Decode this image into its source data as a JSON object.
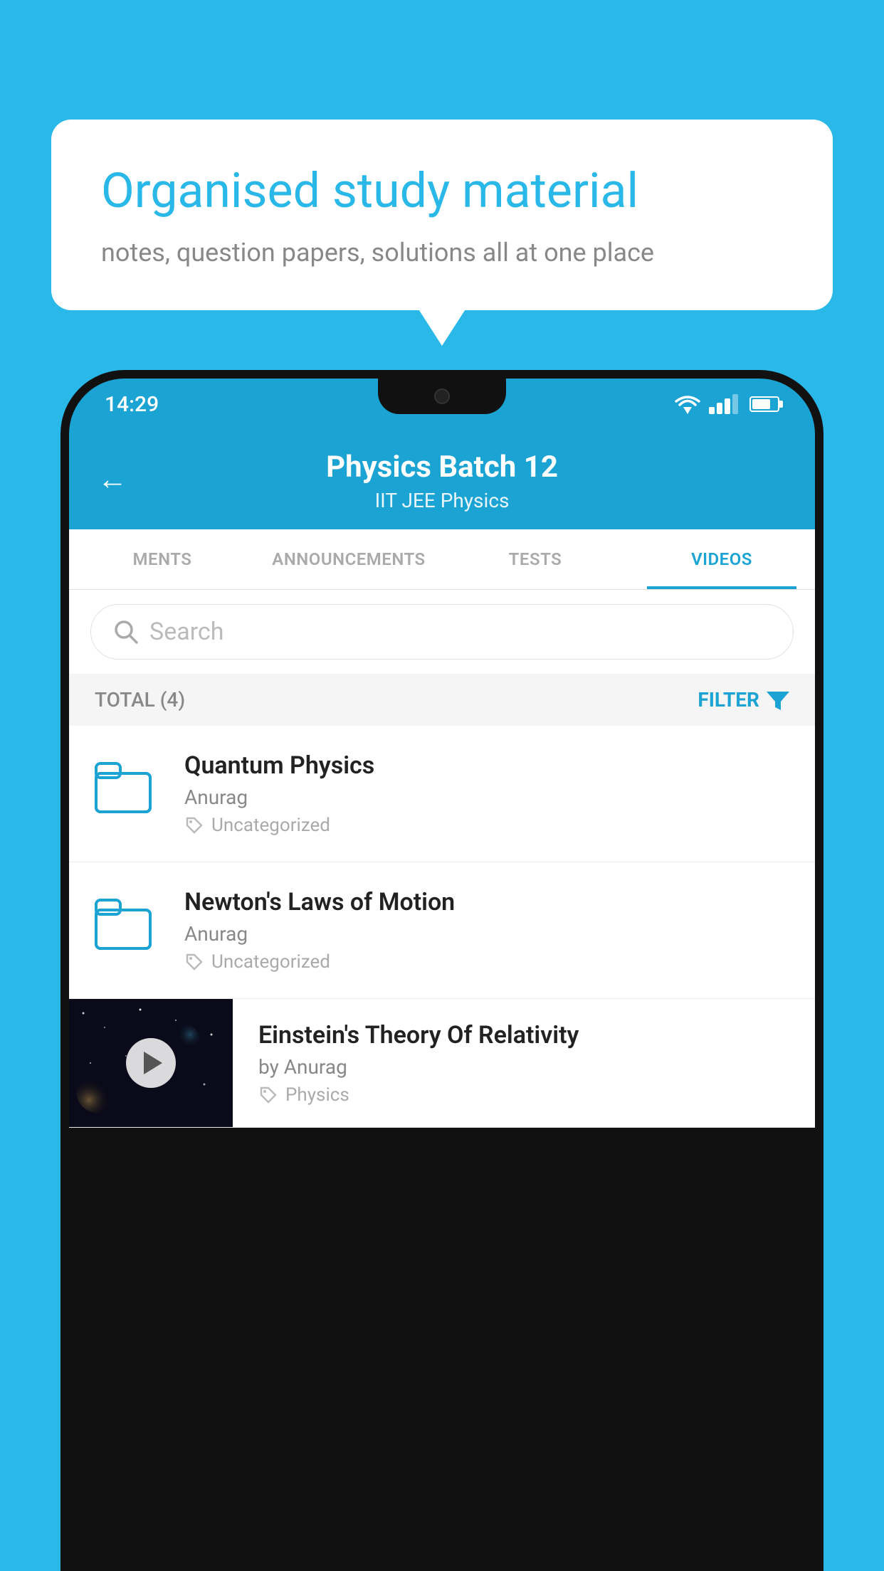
{
  "background_color": "#29b8e8",
  "bubble": {
    "title": "Organised study material",
    "subtitle": "notes, question papers, solutions all at one place"
  },
  "status_bar": {
    "time": "14:29"
  },
  "app_header": {
    "title": "Physics Batch 12",
    "subtitle": "IIT JEE   Physics",
    "back_label": "←"
  },
  "tabs": [
    {
      "label": "MENTS",
      "active": false
    },
    {
      "label": "ANNOUNCEMENTS",
      "active": false
    },
    {
      "label": "TESTS",
      "active": false
    },
    {
      "label": "VIDEOS",
      "active": true
    }
  ],
  "search": {
    "placeholder": "Search"
  },
  "filter_bar": {
    "total_label": "TOTAL (4)",
    "filter_label": "FILTER"
  },
  "videos": [
    {
      "id": 1,
      "title": "Quantum Physics",
      "author": "Anurag",
      "tag": "Uncategorized",
      "type": "folder",
      "has_thumbnail": false
    },
    {
      "id": 2,
      "title": "Newton's Laws of Motion",
      "author": "Anurag",
      "tag": "Uncategorized",
      "type": "folder",
      "has_thumbnail": false
    },
    {
      "id": 3,
      "title": "Einstein's Theory Of Relativity",
      "author": "by Anurag",
      "tag": "Physics",
      "type": "video",
      "has_thumbnail": true
    }
  ]
}
